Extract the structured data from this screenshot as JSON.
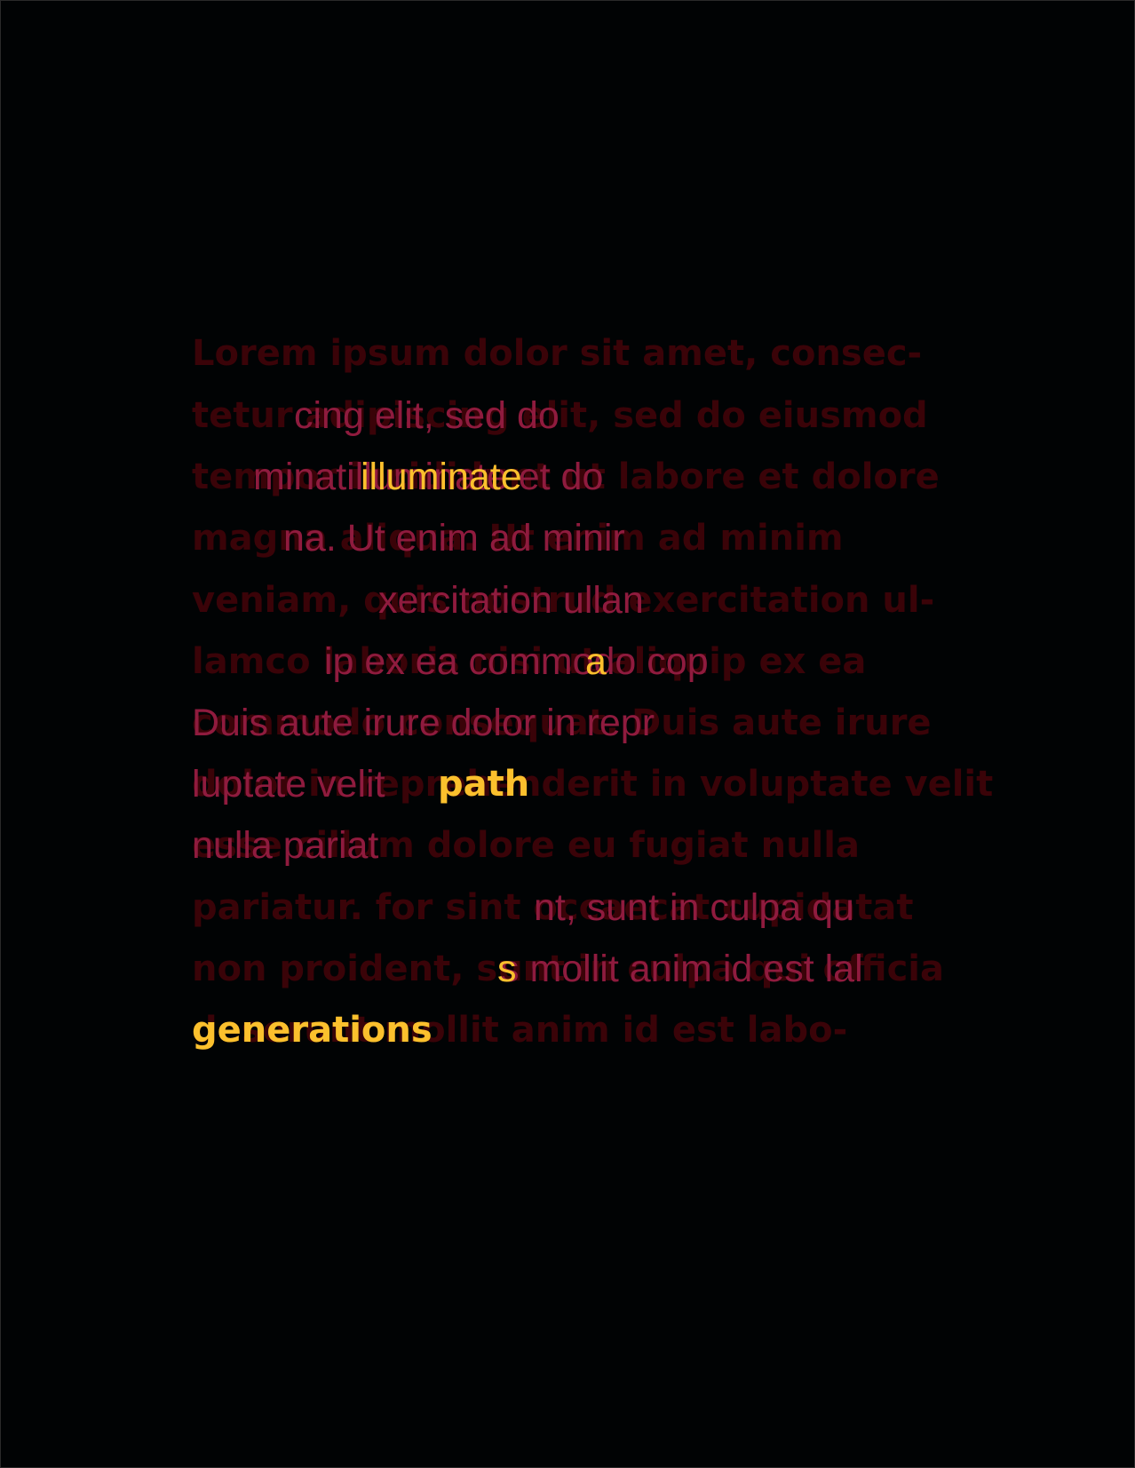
{
  "colors": {
    "background": "#010304",
    "faded_text": "#3a0308",
    "mid_text": "#8f1b3e",
    "highlight": "#fbc02d"
  },
  "background_lines": [
    "Lorem ipsum dolor sit amet, consec-",
    "tetur adipiscing elit, sed do eiusmod",
    "tempor incididunt ut labore et dolore",
    "magna aliqua. Ut enim ad minim",
    "veniam, quis nostrud exercitation ul-",
    "lamco laboris nisi ut aliquip ex ea",
    "commodo consequat. Duis aute irure",
    "dolor in reprehenderit in voluptate velit",
    "esse cillum dolore eu fugiat nulla",
    "pariatur. for sint occaecat cupidatat",
    "non proident, sunt in culpa qui officia",
    "deserunt mollit anim id est labo-"
  ],
  "mid_lines": [
    "cing elit, sed do",
    "minatilluminate et do",
    "na. Ut enim ad minir",
    "xercitation ullan",
    "ip ex ea commodo cop",
    "Duis aute irure dolor in repr",
    "luptate velit",
    "nulla pariat",
    "nt, sunt in culpa qu",
    "s mollit anim id est lal"
  ],
  "highlights": {
    "word1": "illuminate",
    "word2": "a",
    "word3": "path",
    "word4": "s",
    "word5": "generations"
  }
}
